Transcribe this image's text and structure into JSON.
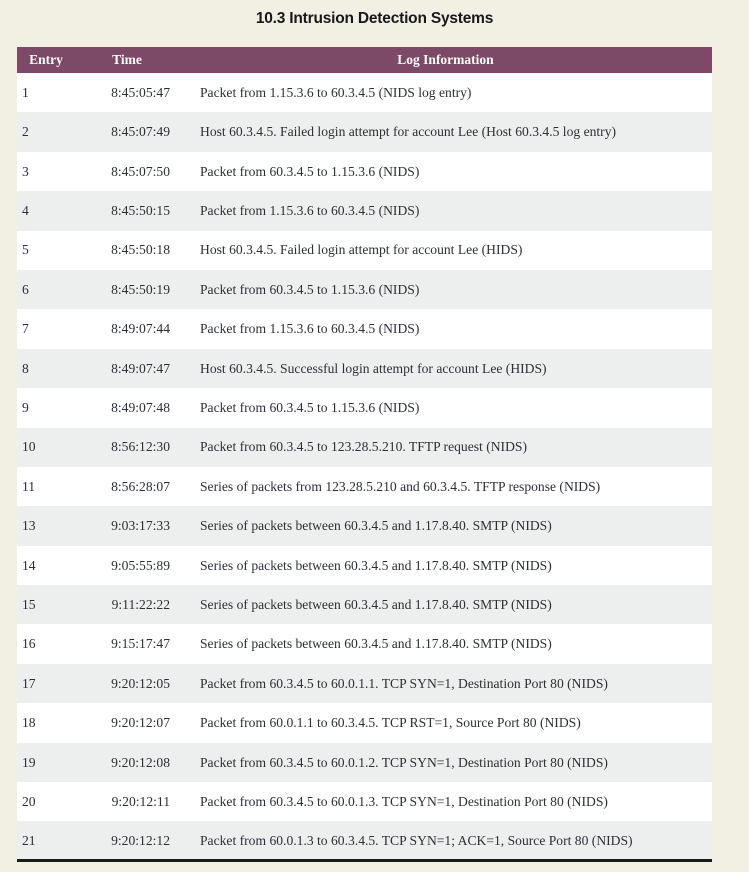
{
  "slide": {
    "title": "10.3 Intrusion Detection Systems",
    "background_color": "#f2efe3",
    "title_color": "#17181a"
  },
  "table": {
    "header_background_color": "#7c4a66",
    "header_text_color": "#fdfcf8",
    "row_odd_color": "#ffffff",
    "row_even_color": "#edeeee",
    "body_text_color": "#2b2f36",
    "bottom_border_color": "#1a1a1a",
    "columns": [
      {
        "key": "entry",
        "label": "Entry"
      },
      {
        "key": "time",
        "label": "Time"
      },
      {
        "key": "info",
        "label": "Log Information"
      }
    ],
    "rows": [
      {
        "entry": "1",
        "time": "8:45:05:47",
        "info": "Packet from 1.15.3.6 to 60.3.4.5 (NIDS log entry)"
      },
      {
        "entry": "2",
        "time": "8:45:07:49",
        "info": "Host 60.3.4.5. Failed login attempt for account Lee (Host 60.3.4.5 log entry)"
      },
      {
        "entry": "3",
        "time": "8:45:07:50",
        "info": "Packet from 60.3.4.5 to 1.15.3.6 (NIDS)"
      },
      {
        "entry": "4",
        "time": "8:45:50:15",
        "info": "Packet from 1.15.3.6 to 60.3.4.5 (NIDS)"
      },
      {
        "entry": "5",
        "time": "8:45:50:18",
        "info": "Host 60.3.4.5. Failed login attempt for account Lee (HIDS)"
      },
      {
        "entry": "6",
        "time": "8:45:50:19",
        "info": "Packet from 60.3.4.5 to 1.15.3.6 (NIDS)"
      },
      {
        "entry": "7",
        "time": "8:49:07:44",
        "info": "Packet from 1.15.3.6 to 60.3.4.5 (NIDS)"
      },
      {
        "entry": "8",
        "time": "8:49:07:47",
        "info": "Host 60.3.4.5. Successful login attempt for account Lee (HIDS)"
      },
      {
        "entry": "9",
        "time": "8:49:07:48",
        "info": "Packet from 60.3.4.5 to 1.15.3.6 (NIDS)"
      },
      {
        "entry": "10",
        "time": "8:56:12:30",
        "info": "Packet from 60.3.4.5 to 123.28.5.210. TFTP request (NIDS)"
      },
      {
        "entry": "11",
        "time": "8:56:28:07",
        "info": "Series of packets from 123.28.5.210 and 60.3.4.5. TFTP response (NIDS)"
      },
      {
        "entry": "13",
        "time": "9:03:17:33",
        "info": "Series of packets between 60.3.4.5 and 1.17.8.40. SMTP (NIDS)"
      },
      {
        "entry": "14",
        "time": "9:05:55:89",
        "info": "Series of packets between 60.3.4.5 and 1.17.8.40. SMTP (NIDS)"
      },
      {
        "entry": "15",
        "time": "9:11:22:22",
        "info": "Series of packets between 60.3.4.5 and 1.17.8.40. SMTP (NIDS)"
      },
      {
        "entry": "16",
        "time": "9:15:17:47",
        "info": "Series of packets between 60.3.4.5 and 1.17.8.40. SMTP (NIDS)"
      },
      {
        "entry": "17",
        "time": "9:20:12:05",
        "info": "Packet from 60.3.4.5 to 60.0.1.1. TCP SYN=1, Destination Port 80 (NIDS)"
      },
      {
        "entry": "18",
        "time": "9:20:12:07",
        "info": "Packet from 60.0.1.1 to 60.3.4.5. TCP RST=1, Source Port 80 (NIDS)"
      },
      {
        "entry": "19",
        "time": "9:20:12:08",
        "info": "Packet from 60.3.4.5 to 60.0.1.2. TCP SYN=1, Destination Port 80 (NIDS)"
      },
      {
        "entry": "20",
        "time": "9:20:12:11",
        "info": "Packet from 60.3.4.5 to 60.0.1.3. TCP SYN=1, Destination Port 80 (NIDS)"
      },
      {
        "entry": "21",
        "time": "9:20:12:12",
        "info": "Packet from 60.0.1.3 to 60.3.4.5. TCP SYN=1; ACK=1, Source Port 80 (NIDS)"
      }
    ]
  }
}
